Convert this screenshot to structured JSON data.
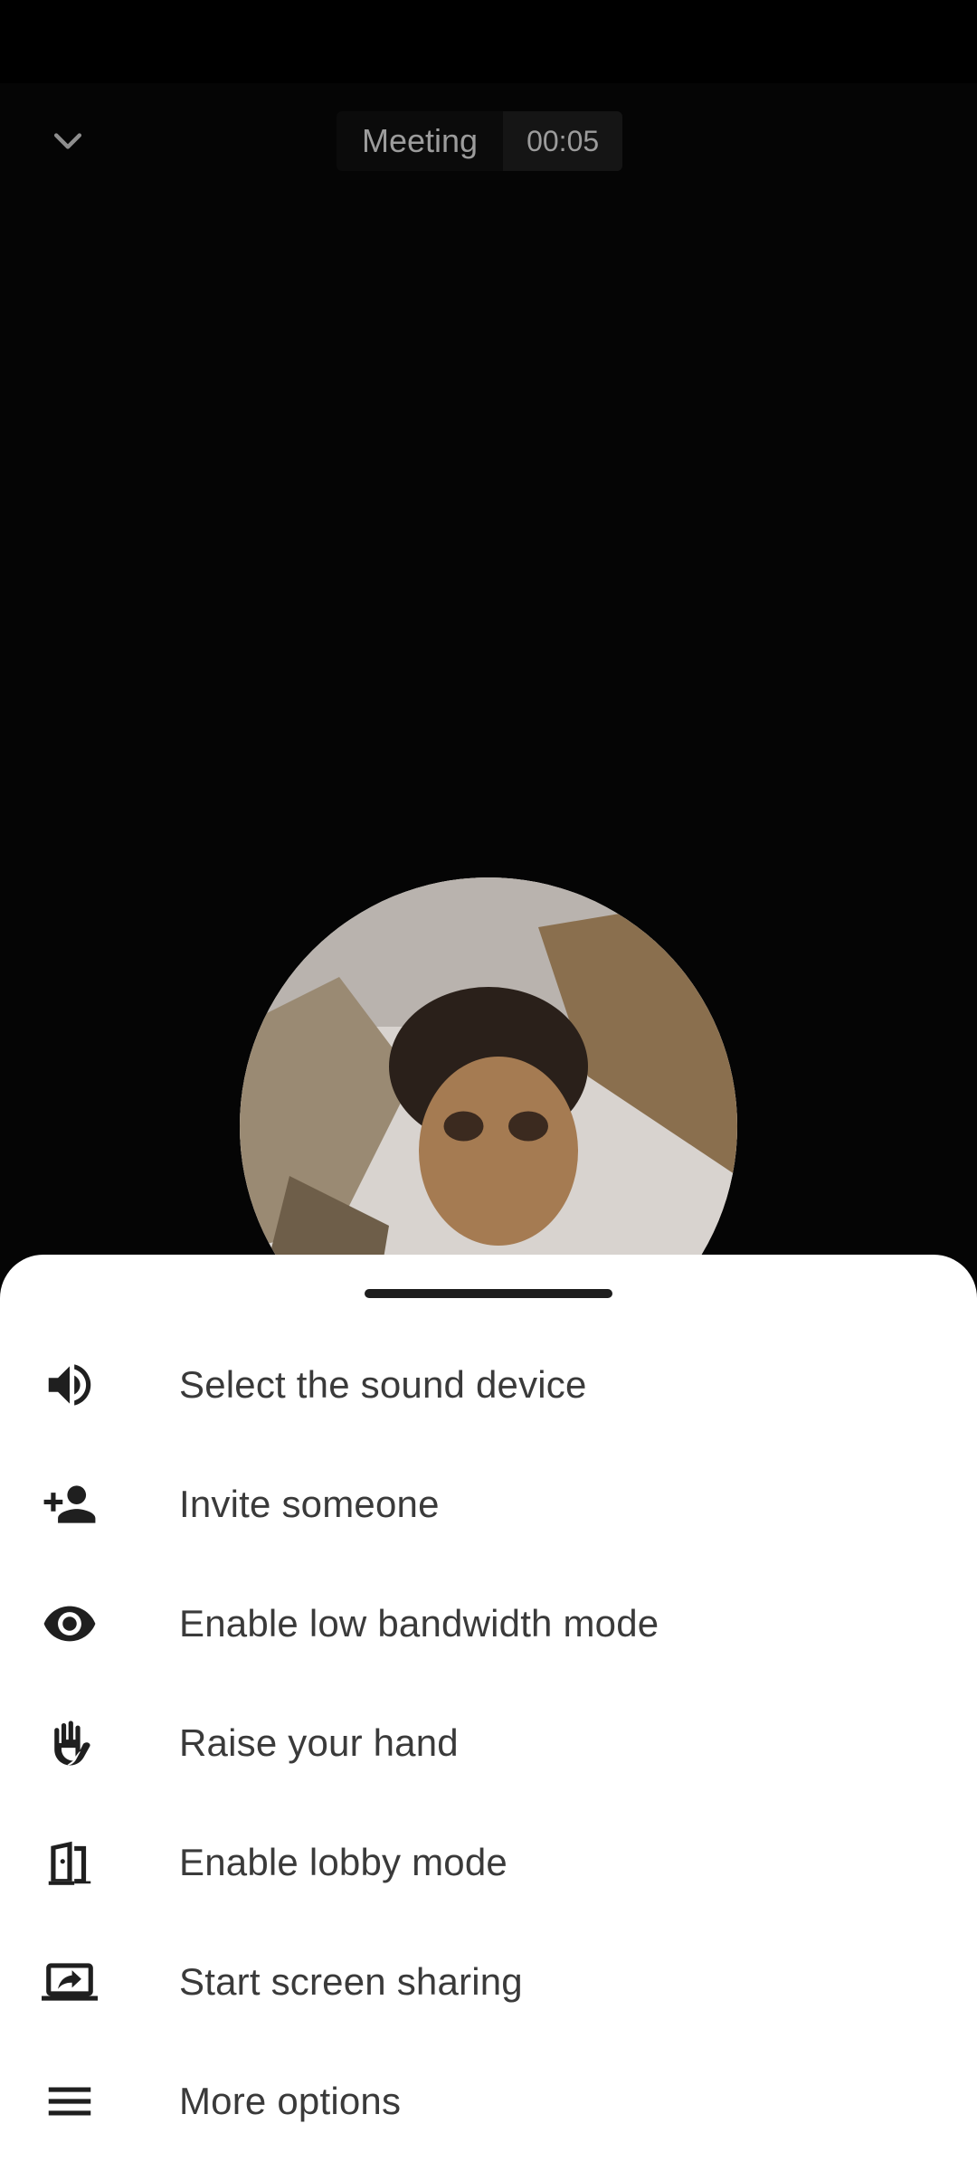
{
  "header": {
    "meeting_title": "Meeting",
    "timer": "00:05",
    "collapse_icon": "chevron-down-icon"
  },
  "participant": {
    "avatar": "participant-avatar-photo"
  },
  "menu": {
    "items": [
      {
        "label": "Select the sound device",
        "icon": "volume-icon"
      },
      {
        "label": "Invite someone",
        "icon": "person-add-icon"
      },
      {
        "label": "Enable low bandwidth mode",
        "icon": "eye-icon"
      },
      {
        "label": "Raise your hand",
        "icon": "hand-icon"
      },
      {
        "label": "Enable lobby mode",
        "icon": "door-icon"
      },
      {
        "label": "Start screen sharing",
        "icon": "screen-share-icon"
      },
      {
        "label": "More options",
        "icon": "menu-icon"
      }
    ]
  },
  "colors": {
    "background": "#000000",
    "sheet": "#ffffff",
    "text_dark": "#3a3a3a",
    "header_text": "#9c9c9c"
  }
}
